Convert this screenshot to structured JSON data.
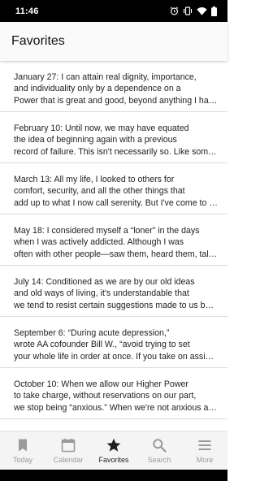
{
  "status_bar": {
    "time": "11:46",
    "icons": [
      "alarm-icon",
      "vibrate-icon",
      "wifi-icon",
      "battery-icon"
    ]
  },
  "app_bar": {
    "title": "Favorites"
  },
  "entries": [
    {
      "lines": [
        "January 27:  I can attain real dignity, importance,",
        "and individuality only by a dependence on a",
        "Power that is great and good, beyond anything I have ever known."
      ]
    },
    {
      "lines": [
        "February 10:  Until now, we may have equated",
        "the idea of beginning again with a previous",
        "record of failure. This isn't necessarily so. Like someone who"
      ]
    },
    {
      "lines": [
        "March 13:  All my life, I looked to others for",
        "comfort, security, and all the other things that",
        "add up to what I now call serenity. But I've come to know that"
      ]
    },
    {
      "lines": [
        "May 18:  I considered myself a “loner” in the days",
        "when I was actively addicted. Although I was",
        "often with other people—saw them, heard them, talked to them"
      ]
    },
    {
      "lines": [
        "July 14:  Conditioned as we are by our old ideas",
        "and old ways of living, it's understandable that",
        "we tend to resist certain suggestions made to us by others"
      ]
    },
    {
      "lines": [
        "September 6:  “During acute depression,”",
        "wrote AA cofounder Bill W., “avoid trying to set",
        "your whole life in order at once. If you take on assignments"
      ]
    },
    {
      "lines": [
        "October 10:  When we allow our Higher Power",
        "to take charge, without reservations on our part,",
        "we stop being “anxious.” When we're not anxious about"
      ]
    }
  ],
  "bottom_nav": {
    "items": [
      {
        "label": "Today",
        "icon": "bookmark-icon"
      },
      {
        "label": "Calendar",
        "icon": "calendar-icon"
      },
      {
        "label": "Favorites",
        "icon": "star-icon",
        "active": true
      },
      {
        "label": "Search",
        "icon": "search-icon"
      },
      {
        "label": "More",
        "icon": "menu-icon"
      }
    ]
  },
  "colors": {
    "active_nav": "#1f1f1f",
    "inactive_nav": "#9a9a9a",
    "divider": "#dcdcdc",
    "status_bar_bg": "#000000"
  }
}
